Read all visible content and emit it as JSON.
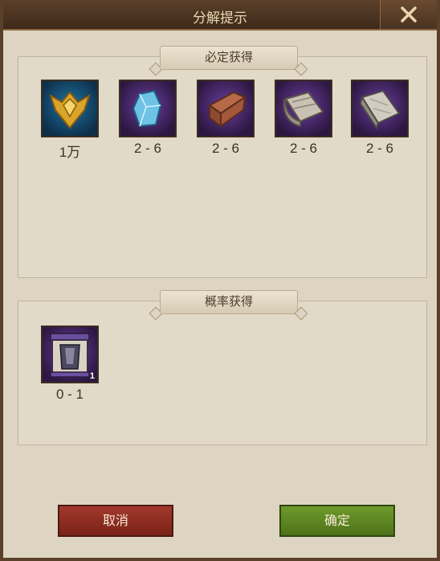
{
  "dialog": {
    "title": "分解提示",
    "close_icon": "close-icon"
  },
  "sections": {
    "guaranteed": {
      "title": "必定获得",
      "items": [
        {
          "icon": "golden-emblem-icon",
          "count": "1万"
        },
        {
          "icon": "blue-crystal-icon",
          "count": "2 - 6"
        },
        {
          "icon": "leather-roll-icon",
          "count": "2 - 6"
        },
        {
          "icon": "cloth-bolt-icon",
          "count": "2 - 6"
        },
        {
          "icon": "iron-ingot-icon",
          "count": "2 - 6"
        }
      ]
    },
    "chance": {
      "title": "概率获得",
      "items": [
        {
          "icon": "armor-scroll-icon",
          "count": "0 - 1",
          "badge": "1"
        }
      ]
    }
  },
  "buttons": {
    "cancel": "取消",
    "confirm": "确定"
  },
  "colors": {
    "cancel": "#8b2a1f",
    "confirm": "#5e8a22",
    "frame": "#4a3322"
  }
}
